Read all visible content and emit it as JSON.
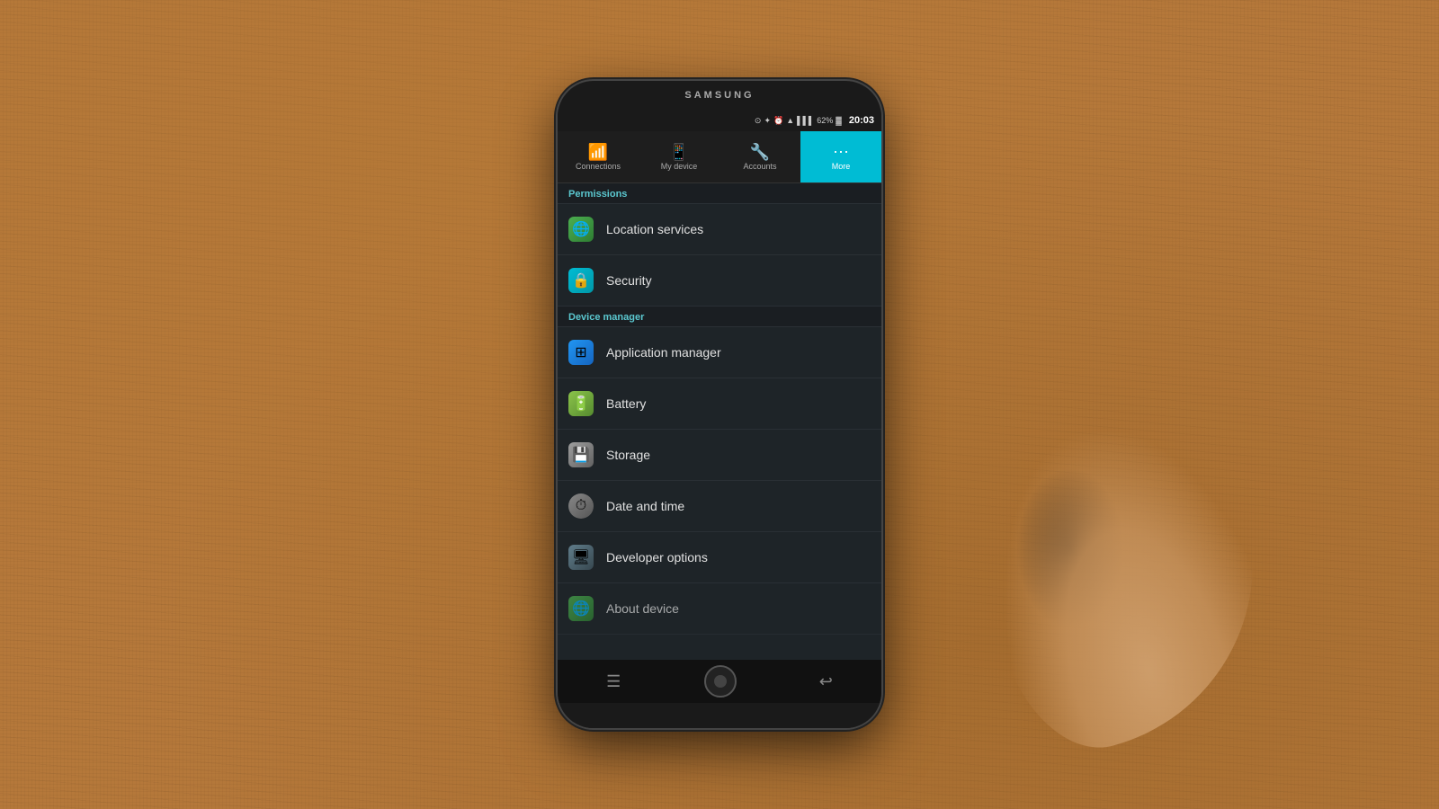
{
  "device": {
    "brand": "SAMSUNG"
  },
  "statusBar": {
    "time": "20:03",
    "battery": "62%",
    "icons": [
      "⊙",
      "✦",
      "⏰",
      "▲",
      "📶"
    ]
  },
  "tabs": [
    {
      "id": "connections",
      "label": "Connections",
      "icon": "📶",
      "active": false
    },
    {
      "id": "my-device",
      "label": "My device",
      "icon": "📱",
      "active": false
    },
    {
      "id": "accounts",
      "label": "Accounts",
      "icon": "🔧",
      "active": false
    },
    {
      "id": "more",
      "label": "More",
      "icon": "⋯",
      "active": true
    }
  ],
  "sections": [
    {
      "id": "permissions",
      "header": "Permissions",
      "items": [
        {
          "id": "location-services",
          "label": "Location services",
          "icon": "🌐",
          "iconClass": "icon-green"
        },
        {
          "id": "security",
          "label": "Security",
          "icon": "🔒",
          "iconClass": "icon-teal"
        }
      ]
    },
    {
      "id": "device-manager",
      "header": "Device manager",
      "items": [
        {
          "id": "application-manager",
          "label": "Application manager",
          "icon": "⊞",
          "iconClass": "icon-blue"
        },
        {
          "id": "battery",
          "label": "Battery",
          "icon": "🔋",
          "iconClass": "icon-lime"
        },
        {
          "id": "storage",
          "label": "Storage",
          "icon": "💾",
          "iconClass": "icon-grey"
        },
        {
          "id": "date-and-time",
          "label": "Date and time",
          "icon": "⏱",
          "iconClass": "icon-dark"
        },
        {
          "id": "developer-options",
          "label": "Developer options",
          "icon": "🖥",
          "iconClass": "icon-dark"
        },
        {
          "id": "about-device",
          "label": "About device",
          "icon": "🌐",
          "iconClass": "icon-green"
        }
      ]
    }
  ],
  "bottomNav": {
    "menu": "☰",
    "home": "",
    "back": "↩"
  }
}
